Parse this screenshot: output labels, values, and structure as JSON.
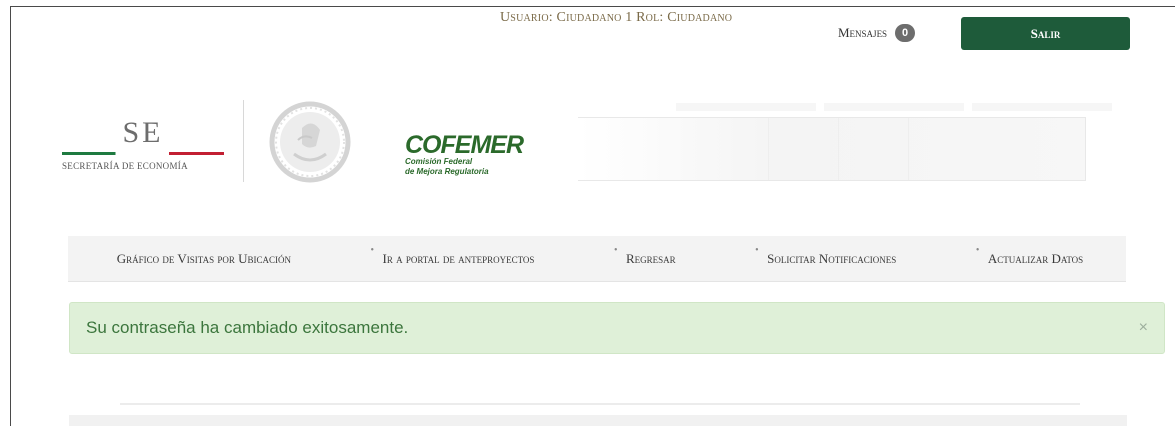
{
  "header": {
    "user_info": "Usuario: Ciudadano 1 Rol: Ciudadano",
    "messages_label": "Mensajes",
    "messages_count": "0",
    "logout_label": "Salir"
  },
  "logos": {
    "se_abbrev": "SE",
    "se_name": "SECRETARÍA DE ECONOMÍA",
    "cofemer_name": "COFEMER",
    "cofemer_sub1": "Comisión Federal",
    "cofemer_sub2": "de Mejora Regulatoria",
    "flag_colors": [
      "#1e7a40",
      "#ffffff",
      "#c21f32"
    ]
  },
  "nav": {
    "items": [
      {
        "label": "Gráfico de Visitas por Ubicación"
      },
      {
        "label": "Ir a portal de anteproyectos"
      },
      {
        "label": "Regresar"
      },
      {
        "label": "Solicitar Notificaciones"
      },
      {
        "label": "Actualizar Datos"
      }
    ]
  },
  "alert": {
    "message": "Su contraseña ha cambiado exitosamente.",
    "close_symbol": "×",
    "color": "#3c763d",
    "background": "#dff0d8"
  },
  "colors": {
    "brand_green": "#1e5b3a"
  }
}
